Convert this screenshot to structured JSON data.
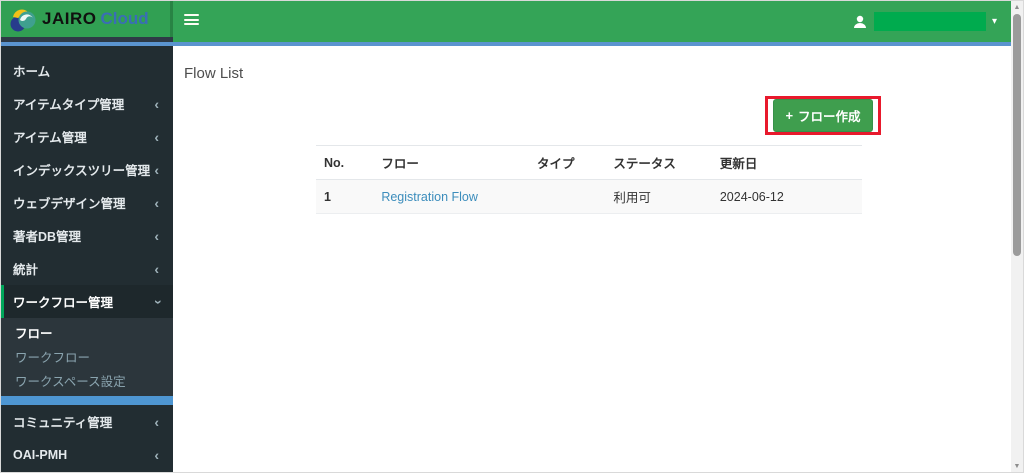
{
  "app": {
    "brand": "JAIRO",
    "brand_suffix": "Cloud"
  },
  "header": {
    "user_name_redacted": true
  },
  "icons": {
    "angle_left": "‹",
    "caret_down": "▾",
    "plus": "+",
    "scroll_up": "▲",
    "scroll_down": "▼"
  },
  "sidebar": {
    "items": [
      {
        "label": "ホーム",
        "expandable": false
      },
      {
        "label": "アイテムタイプ管理",
        "expandable": true
      },
      {
        "label": "アイテム管理",
        "expandable": true
      },
      {
        "label": "インデックスツリー管理",
        "expandable": true
      },
      {
        "label": "ウェブデザイン管理",
        "expandable": true
      },
      {
        "label": "著者DB管理",
        "expandable": true
      },
      {
        "label": "統計",
        "expandable": true
      },
      {
        "label": "ワークフロー管理",
        "expandable": true,
        "expanded": true,
        "active": true
      },
      {
        "label": "コミュニティ管理",
        "expandable": true
      },
      {
        "label": "OAI-PMH",
        "expandable": true
      }
    ],
    "submenu_items": [
      {
        "label": "フロー",
        "active": true
      },
      {
        "label": "ワークフロー",
        "active": false
      },
      {
        "label": "ワークスペース設定",
        "active": false
      }
    ]
  },
  "main": {
    "page_title": "Flow List",
    "create_button": {
      "label": "フロー作成"
    },
    "table": {
      "headers": [
        "No.",
        "フロー",
        "タイプ",
        "ステータス",
        "更新日"
      ],
      "rows": [
        {
          "no": "1",
          "flow": "Registration Flow",
          "type": "",
          "status": "利用可",
          "updated": "2024-06-12"
        }
      ]
    }
  },
  "colors": {
    "header_green": "#34a457",
    "redaction_green": "#00ab4e",
    "sidebar_dark": "#222d32",
    "submenu_dark": "#2c363c",
    "active_item_green": "#00a65a",
    "submenu_blue_bar": "#4e96d2",
    "header_blue_line": "#5b94cf",
    "link_blue": "#3c8dbc",
    "button_green": "#3f9e4e",
    "annotation_red": "#e8192c",
    "brand_blue": "#3a6db6"
  }
}
